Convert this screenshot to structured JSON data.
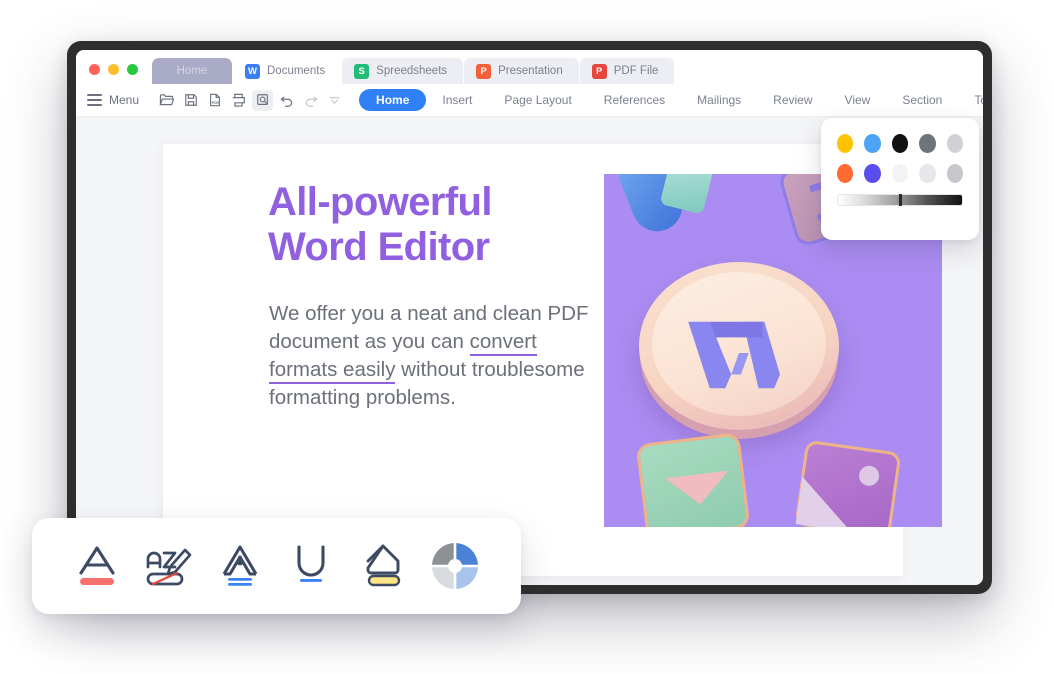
{
  "window": {
    "traffic_lights": [
      {
        "name": "close",
        "color": "#ff6058"
      },
      {
        "name": "minimize",
        "color": "#ffbd2e"
      },
      {
        "name": "maximize",
        "color": "#28c840"
      }
    ],
    "app_tabs": [
      {
        "label": "Home",
        "icon": "home-tab",
        "icon_color": "",
        "active": true
      },
      {
        "label": "Documents",
        "icon": "word-icon",
        "icon_color": "#3b7df5",
        "icon_letter": "W",
        "active": false
      },
      {
        "label": "Spreedsheets",
        "icon": "spreadsheet-icon",
        "icon_color": "#22bb77",
        "icon_letter": "S",
        "active": false
      },
      {
        "label": "Presentation",
        "icon": "presentation-icon",
        "icon_color": "#f4603a",
        "icon_letter": "P",
        "active": false
      },
      {
        "label": "PDF File",
        "icon": "pdf-icon",
        "icon_color": "#e8453c",
        "icon_letter": "P",
        "active": false
      }
    ]
  },
  "ribbon": {
    "menu_label": "Menu",
    "quick_access": [
      {
        "name": "open-folder-icon"
      },
      {
        "name": "save-icon"
      },
      {
        "name": "export-pdf-icon"
      },
      {
        "name": "print-icon"
      },
      {
        "name": "print-preview-icon",
        "active": true
      },
      {
        "name": "undo-icon"
      },
      {
        "name": "redo-icon"
      },
      {
        "name": "chevron-down-icon"
      }
    ],
    "tabs": [
      {
        "label": "Home",
        "selected": true
      },
      {
        "label": "Insert",
        "selected": false
      },
      {
        "label": "Page Layout",
        "selected": false
      },
      {
        "label": "References",
        "selected": false
      },
      {
        "label": "Mailings",
        "selected": false
      },
      {
        "label": "Review",
        "selected": false
      },
      {
        "label": "View",
        "selected": false
      },
      {
        "label": "Section",
        "selected": false
      },
      {
        "label": "Tools",
        "selected": false
      }
    ],
    "accent_color": "#2f7ff5"
  },
  "document": {
    "title_line1": "All-powerful",
    "title_line2": "Word Editor",
    "title_color": "#9160e0",
    "body_part1": "We offer you a neat and clean PDF document as you can ",
    "body_underlined": "convert formats easily",
    "body_part2": " without troublesome formatting problems.",
    "body_color": "#6c7079",
    "image_alt": "wps-3d-coin-illustration",
    "image_background": "#ab8cf2"
  },
  "color_panel": {
    "row1": [
      "#ffc400",
      "#4da3f5",
      "#121212",
      "#6e7478",
      "#cfd1d4"
    ],
    "row2": [
      "#ff6a33",
      "#5a4df0",
      "#f3f3f5",
      "#e6e7ea",
      "#c5c7cb"
    ],
    "gradient_label": "grayscale-slider",
    "gradient_value": 49
  },
  "format_toolbar": {
    "buttons": [
      {
        "name": "font-color",
        "glyph": "A",
        "bar_color": "#f7726c"
      },
      {
        "name": "text-highlight-remove",
        "glyph": "ab",
        "bar_color": "#e8453c"
      },
      {
        "name": "text-effect-outline",
        "glyph": "A",
        "bar_color": "#3b82f6"
      },
      {
        "name": "underline",
        "glyph": "U",
        "bar_color": "#3b82f6"
      },
      {
        "name": "highlighter-pen",
        "glyph": "pen",
        "bar_color": "#fbe585"
      },
      {
        "name": "color-wheel",
        "glyph": "wheel",
        "bar_color": "#4b82d8"
      }
    ]
  }
}
